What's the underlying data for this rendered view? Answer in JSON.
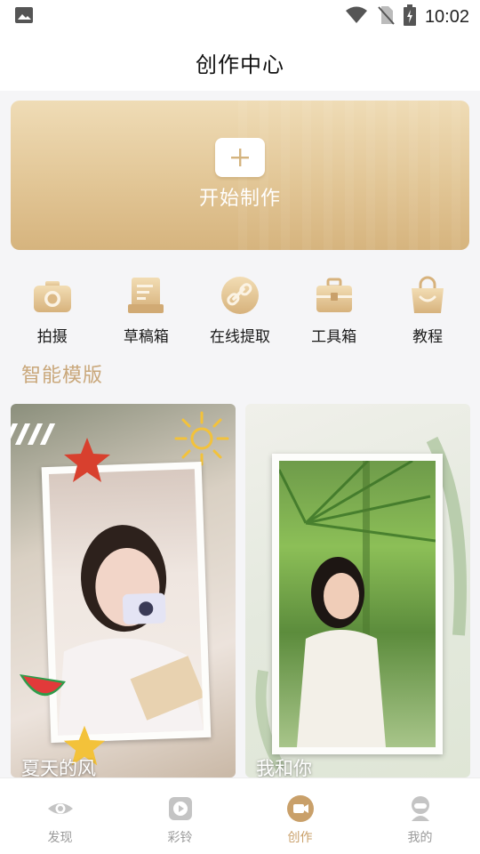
{
  "status_bar": {
    "time": "10:02",
    "icons": [
      "image-icon",
      "wifi-icon",
      "no-sim-icon",
      "battery-charging-icon"
    ]
  },
  "header": {
    "title": "创作中心"
  },
  "create_card": {
    "label": "开始制作",
    "icon": "plus-icon"
  },
  "tools": [
    {
      "label": "拍摄",
      "icon": "camera-icon"
    },
    {
      "label": "草稿箱",
      "icon": "drafts-icon"
    },
    {
      "label": "在线提取",
      "icon": "link-icon"
    },
    {
      "label": "工具箱",
      "icon": "toolbox-icon"
    },
    {
      "label": "教程",
      "icon": "tutorial-bag-icon"
    }
  ],
  "templates": {
    "section_title": "智能模版",
    "items": [
      {
        "name": "夏天的风"
      },
      {
        "name": "我和你"
      }
    ]
  },
  "bottom_nav": {
    "items": [
      {
        "label": "发现",
        "icon": "eye-icon",
        "active": false
      },
      {
        "label": "彩铃",
        "icon": "play-icon",
        "active": false
      },
      {
        "label": "创作",
        "icon": "video-camera-icon",
        "active": true
      },
      {
        "label": "我的",
        "icon": "profile-icon",
        "active": false
      }
    ]
  },
  "colors": {
    "accent": "#c9a06a",
    "card_gradient_top": "#efdcb6",
    "card_gradient_bottom": "#d6b47e",
    "section_title": "#c9a77a",
    "inactive": "#9a9a9a"
  }
}
